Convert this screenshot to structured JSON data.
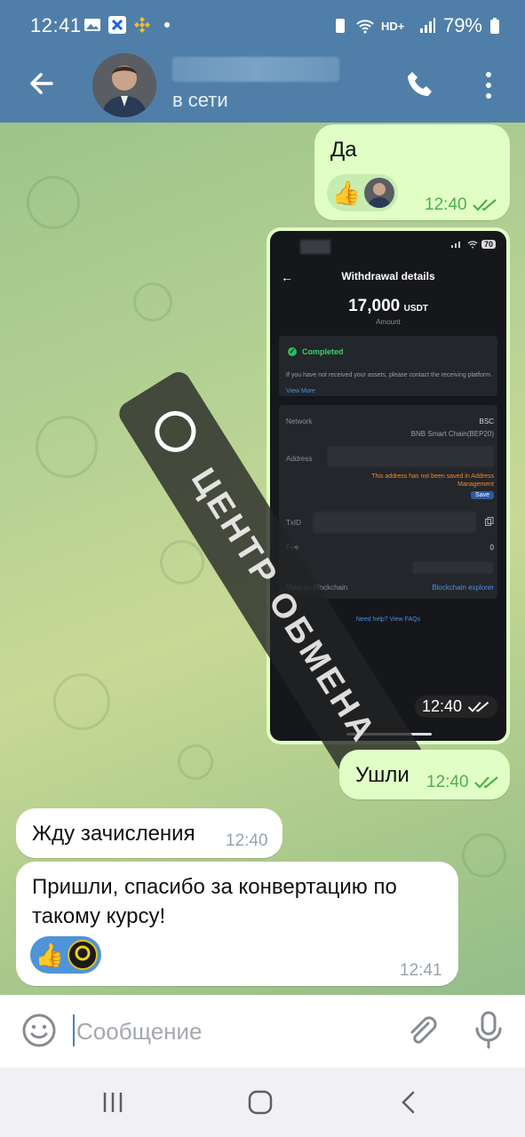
{
  "status_bar": {
    "time": "12:41",
    "battery": "79%"
  },
  "header": {
    "status": "в сети"
  },
  "messages": {
    "m1_text": "Да",
    "m1_time": "12:40",
    "image_time": "12:40",
    "m2_text": "Ушли",
    "m2_time": "12:40",
    "m3_text": "Жду зачисления",
    "m3_time": "12:40",
    "m4_text": "Пришли, спасибо за конвертацию по такому курсу!",
    "m4_time": "12:41"
  },
  "screenshot": {
    "battery": "70",
    "title": "Withdrawal details",
    "amount": "17,000",
    "unit": "USDT",
    "amount_label": "Amount",
    "status": "Completed",
    "notice": "If you have not received your assets, please contact the receiving platform.",
    "view_more": "View More",
    "network_label": "Network",
    "network_value": "BSC",
    "network_sub": "BNB Smart Chain(BEP20)",
    "address_label": "Address",
    "address_warning": "This address has not been saved in Address Management",
    "save": "Save",
    "txid_label": "TxID",
    "fee_label": "Fee",
    "fee_value": "0",
    "blockchain_label": "View on Blockchain",
    "blockchain_link": "Blockchain explorer",
    "help": "Need help? View FAQs",
    "time": "12:40"
  },
  "watermark": {
    "text": "ЦЕНТР ОБМЕНА",
    "logo_text": "ЦЕНТР ОБМЕНА"
  },
  "input": {
    "placeholder": "Сообщение"
  },
  "colors": {
    "header": "#4f7fa8",
    "bubble_out": "#e1fec6",
    "bubble_in": "#ffffff",
    "checks": "#4fae4e"
  },
  "icons": [
    "back-arrow-icon",
    "phone-icon",
    "more-vert-icon",
    "thumbs-up-icon",
    "double-check-icon",
    "emoji-icon",
    "attach-icon",
    "mic-icon",
    "recent-apps-icon",
    "home-icon",
    "nav-back-icon"
  ]
}
